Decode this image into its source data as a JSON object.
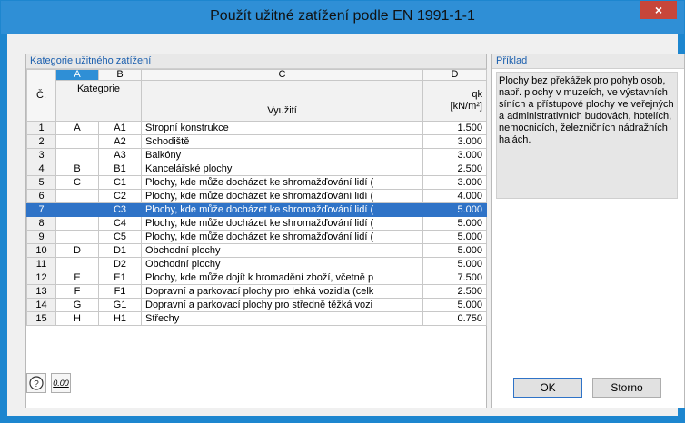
{
  "window": {
    "title": "Použít užitné zatížení podle EN 1991-1-1",
    "close_label": "×"
  },
  "left_panel": {
    "header": "Kategorie užitného zatížení",
    "column_letters": [
      "A",
      "B",
      "C",
      "D"
    ],
    "col_num_header": "Č.",
    "col_kategorie": "Kategorie",
    "col_vyuziti": "Využití",
    "col_qk_line1": "qk",
    "col_qk_line2": "[kN/m²]",
    "rows": [
      {
        "n": "1",
        "a": "A",
        "b": "A1",
        "c": "Stropní konstrukce",
        "d": "1.500"
      },
      {
        "n": "2",
        "a": "",
        "b": "A2",
        "c": "Schodiště",
        "d": "3.000"
      },
      {
        "n": "3",
        "a": "",
        "b": "A3",
        "c": "Balkóny",
        "d": "3.000"
      },
      {
        "n": "4",
        "a": "B",
        "b": "B1",
        "c": "Kancelářské plochy",
        "d": "2.500"
      },
      {
        "n": "5",
        "a": "C",
        "b": "C1",
        "c": "Plochy, kde může docházet ke shromažďování lidí (",
        "d": "3.000"
      },
      {
        "n": "6",
        "a": "",
        "b": "C2",
        "c": "Plochy, kde může docházet ke shromažďování lidí (",
        "d": "4.000"
      },
      {
        "n": "7",
        "a": "",
        "b": "C3",
        "c": "Plochy, kde může docházet ke shromažďování lidí (",
        "d": "5.000"
      },
      {
        "n": "8",
        "a": "",
        "b": "C4",
        "c": "Plochy, kde může docházet ke shromažďování lidí (",
        "d": "5.000"
      },
      {
        "n": "9",
        "a": "",
        "b": "C5",
        "c": "Plochy, kde může docházet ke shromažďování lidí (",
        "d": "5.000"
      },
      {
        "n": "10",
        "a": "D",
        "b": "D1",
        "c": "Obchodní plochy",
        "d": "5.000"
      },
      {
        "n": "11",
        "a": "",
        "b": "D2",
        "c": "Obchodní plochy",
        "d": "5.000"
      },
      {
        "n": "12",
        "a": "E",
        "b": "E1",
        "c": "Plochy, kde může dojít k hromadění zboží, včetně p",
        "d": "7.500"
      },
      {
        "n": "13",
        "a": "F",
        "b": "F1",
        "c": "Dopravní a parkovací plochy pro lehká vozidla (celk",
        "d": "2.500"
      },
      {
        "n": "14",
        "a": "G",
        "b": "G1",
        "c": "Dopravní a parkovací plochy pro středně těžká vozi",
        "d": "5.000"
      },
      {
        "n": "15",
        "a": "H",
        "b": "H1",
        "c": "Střechy",
        "d": "0.750"
      }
    ],
    "selected_row": "7"
  },
  "right_panel": {
    "header": "Příklad",
    "text": "Plochy bez překážek pro pohyb osob, např. plochy v muzeích, ve výstavních síních a přístupové plochy ve veřejných a administrativních budovách, hotelích, nemocnicích, železničních nádražních halách."
  },
  "footer": {
    "help_icon": "help-icon",
    "units_icon": "decimal-places-icon",
    "units_icon_label": "0.00",
    "ok_label": "OK",
    "cancel_label": "Storno"
  },
  "colors": {
    "title_bar": "#2f8fd6",
    "selection": "#2f73c7",
    "close_button": "#c7463a",
    "header_text": "#1b5fae"
  }
}
